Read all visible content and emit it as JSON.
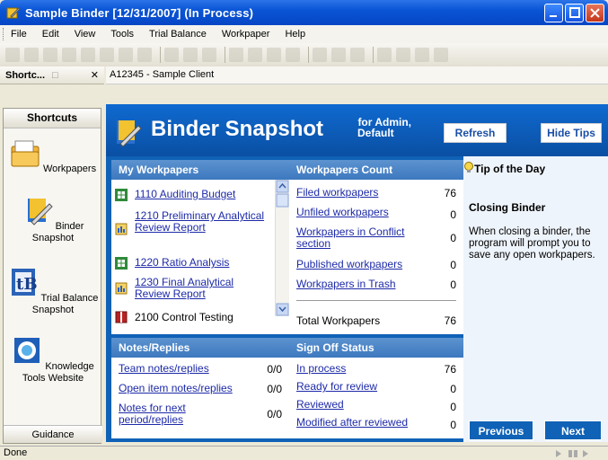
{
  "window": {
    "title": "Sample Binder  [12/31/2007]  (In Process)"
  },
  "menu": [
    "File",
    "Edit",
    "View",
    "Tools",
    "Trial Balance",
    "Workpaper",
    "Help"
  ],
  "left": {
    "pane_title": "Shortc...",
    "section": "Shortcuts",
    "items": [
      "Workpapers",
      "Binder Snapshot",
      "Trial Balance Snapshot",
      "Knowledge Tools Website"
    ],
    "guidance": "Guidance"
  },
  "client": "A12345 - Sample Client",
  "banner": {
    "title": "Binder Snapshot",
    "for_line1": "for Admin,",
    "for_line2": "Default",
    "refresh": "Refresh",
    "hide_tips": "Hide Tips"
  },
  "my_workpapers": {
    "header": "My Workpapers",
    "items": [
      {
        "label": "1110 Auditing Budget",
        "icon": "spreadsheet-icon",
        "link": true
      },
      {
        "label": "1210 Preliminary Analytical Review Report",
        "icon": "report-icon",
        "link": true
      },
      {
        "label": "1220 Ratio Analysis",
        "icon": "spreadsheet-icon",
        "link": true
      },
      {
        "label": "1230 Final Analytical Review Report",
        "icon": "report-icon",
        "link": true
      },
      {
        "label": "2100 Control Testing",
        "icon": "book-icon",
        "link": false
      }
    ]
  },
  "workpapers_count": {
    "header": "Workpapers Count",
    "rows": [
      {
        "label": "Filed workpapers",
        "value": "76"
      },
      {
        "label": "Unfiled workpapers",
        "value": "0"
      },
      {
        "label": "Workpapers in Conflict section",
        "value": "0"
      },
      {
        "label": "Published workpapers",
        "value": "0"
      },
      {
        "label": "Workpapers in Trash",
        "value": "0"
      }
    ],
    "total_label": "Total Workpapers",
    "total_value": "76"
  },
  "notes": {
    "header": "Notes/Replies",
    "rows": [
      {
        "label": "Team notes/replies",
        "value": "0/0"
      },
      {
        "label": "Open item notes/replies",
        "value": "0/0"
      },
      {
        "label": "Notes for next period/replies",
        "value": "0/0"
      }
    ]
  },
  "signoff": {
    "header": "Sign Off Status",
    "rows": [
      {
        "label": "In process",
        "value": "76"
      },
      {
        "label": "Ready for review",
        "value": "0"
      },
      {
        "label": "Reviewed",
        "value": "0"
      },
      {
        "label": "Modified after reviewed",
        "value": "0"
      }
    ]
  },
  "tip": {
    "title": "Tip of the Day",
    "heading": "Closing Binder",
    "body": "When closing a binder, the program will prompt you to save any open workpapers.",
    "previous": "Previous",
    "next": "Next"
  },
  "status": "Done",
  "colors": {
    "title_bar": "#0a55d6",
    "banner": "#0f62b6",
    "panel_header": "#4a84c6",
    "link": "#1d2aa8"
  }
}
